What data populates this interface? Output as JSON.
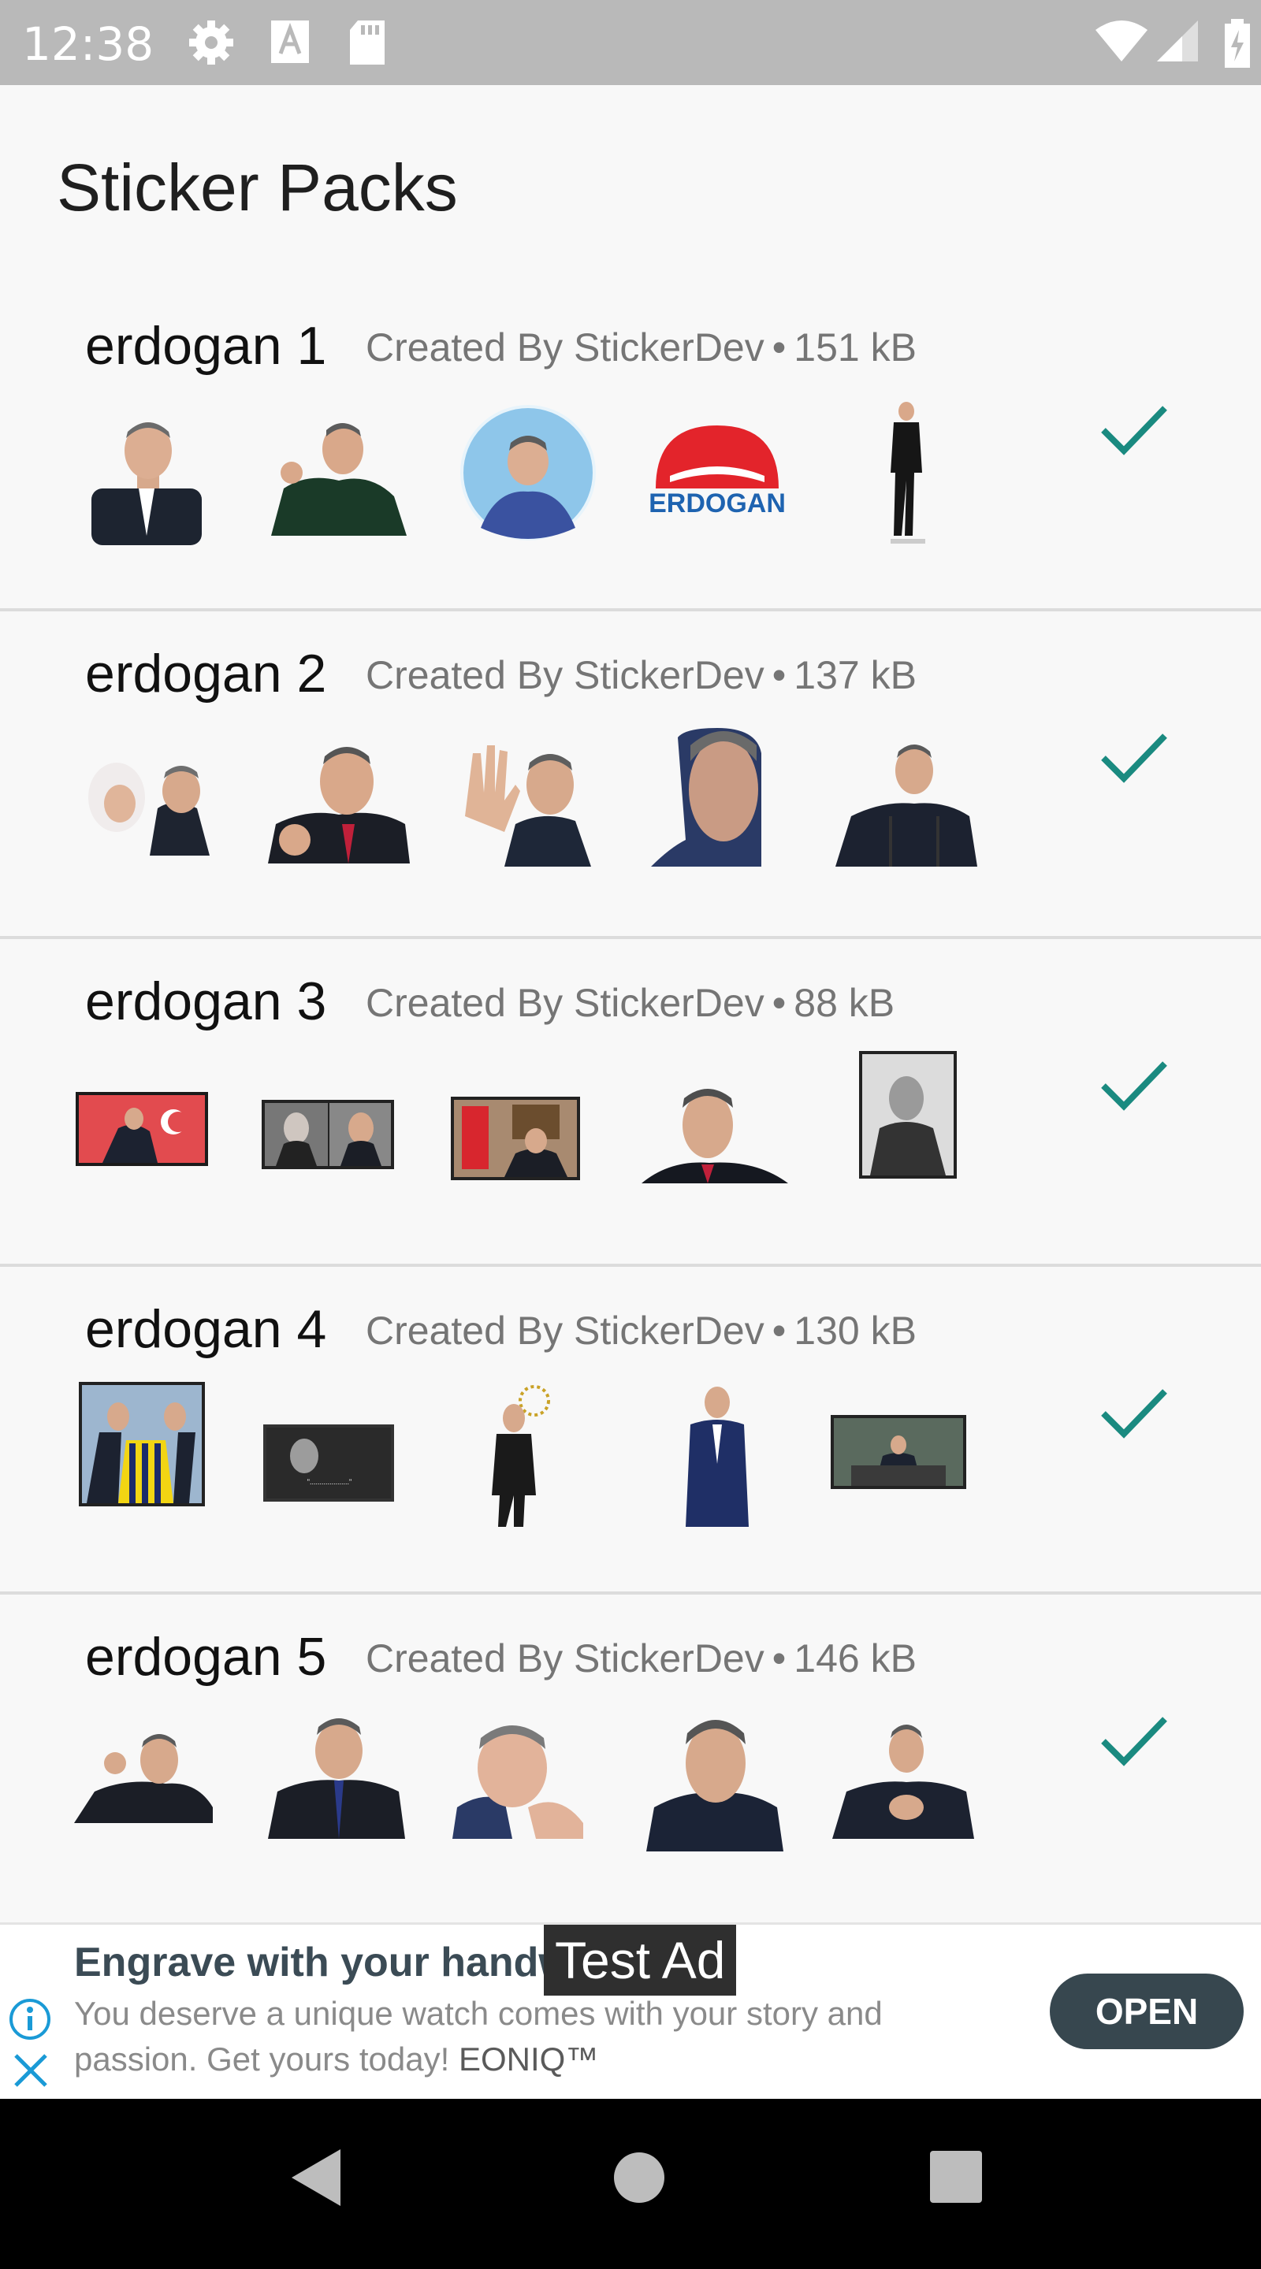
{
  "status_bar": {
    "time": "12:38",
    "icons": [
      "gear-icon",
      "font-a-icon",
      "sd-card-icon",
      "wifi-icon",
      "signal-icon",
      "battery-charging-icon"
    ]
  },
  "header": {
    "title": "Sticker Packs"
  },
  "packs": [
    {
      "name": "erdogan 1",
      "author": "Created By StickerDev",
      "separator": "•",
      "size": "151 kB",
      "added": true
    },
    {
      "name": "erdogan 2",
      "author": "Created By StickerDev",
      "separator": "•",
      "size": "137 kB",
      "added": true
    },
    {
      "name": "erdogan 3",
      "author": "Created By StickerDev",
      "separator": "•",
      "size": "88 kB",
      "added": true
    },
    {
      "name": "erdogan 4",
      "author": "Created By StickerDev",
      "separator": "•",
      "size": "130 kB",
      "added": true
    },
    {
      "name": "erdogan 5",
      "author": "Created By StickerDev",
      "separator": "•",
      "size": "146 kB",
      "added": true
    }
  ],
  "ad": {
    "title": "Engrave with your handw",
    "badge": "Test Ad",
    "body": "You deserve a unique watch comes with your story and passion. Get yours today!",
    "brand": "EONIQ™",
    "cta": "OPEN"
  },
  "colors": {
    "accent": "#1a8a80",
    "status_bar": "#b9b9b9",
    "ad_button": "#37474f"
  }
}
